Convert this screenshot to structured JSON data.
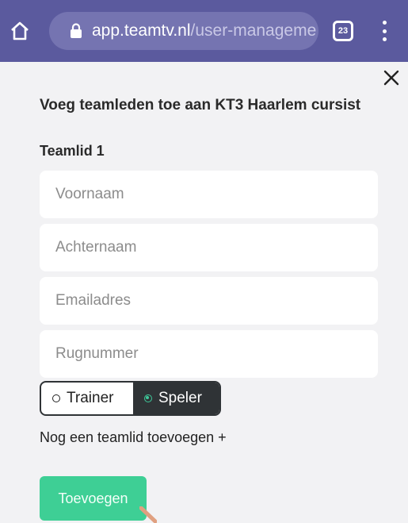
{
  "browser": {
    "url_host": "app.teamtv.nl",
    "url_path": "/user-manageme",
    "tab_count": "23",
    "icons": {
      "home": "home-icon",
      "lock": "lock-icon",
      "tabs": "tabs-icon",
      "menu": "more-vert-icon"
    },
    "bar_color": "#5b5a9e"
  },
  "dialog": {
    "close_icon": "close-icon",
    "title": "Voeg teamleden toe aan KT3 Haarlem cursist",
    "member_heading": "Teamlid 1",
    "fields": {
      "first_name": {
        "placeholder": "Voornaam",
        "value": ""
      },
      "last_name": {
        "placeholder": "Achternaam",
        "value": ""
      },
      "email": {
        "placeholder": "Emailadres",
        "value": ""
      },
      "number": {
        "placeholder": "Rugnummer",
        "value": ""
      }
    },
    "role": {
      "options": [
        "Trainer",
        "Speler"
      ],
      "selected": "Speler"
    },
    "add_another": "Nog een teamlid toevoegen +",
    "submit_label": "Toevoegen",
    "accent_color": "#3ecf95"
  }
}
